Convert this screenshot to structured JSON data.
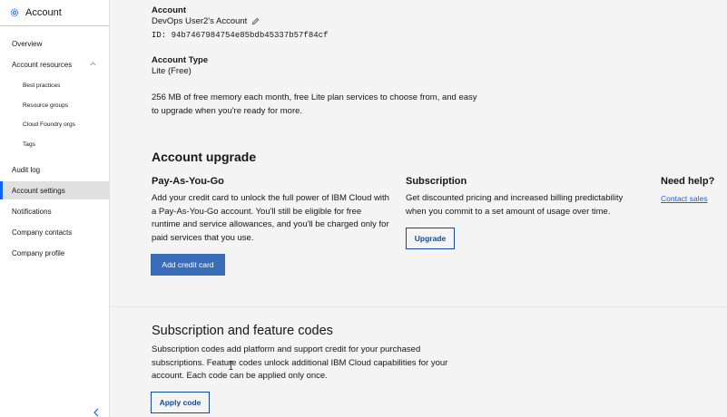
{
  "sidebar": {
    "title": "Account",
    "items": [
      {
        "label": "Overview"
      },
      {
        "label": "Account resources"
      },
      {
        "label": "Best practices"
      },
      {
        "label": "Resource groups"
      },
      {
        "label": "Cloud Foundry orgs"
      },
      {
        "label": "Tags"
      },
      {
        "label": "Audit log"
      },
      {
        "label": "Account settings"
      },
      {
        "label": "Notifications"
      },
      {
        "label": "Company contacts"
      },
      {
        "label": "Company profile"
      }
    ],
    "active_item": "Account settings"
  },
  "account": {
    "heading": "Account",
    "name": "DevOps User2's Account",
    "id": "ID: 94b7467984754e85bdb45337b57f84cf",
    "type_heading": "Account Type",
    "type_value": "Lite (Free)",
    "description_line1": "256 MB of free memory each month, free Lite plan services to choose from, and easy",
    "description_line2": "to upgrade when you're ready for more."
  },
  "upgrade": {
    "heading": "Account upgrade",
    "payg": {
      "title": "Pay-As-You-Go",
      "lines": [
        "Add your credit card to unlock the full power of IBM Cloud with",
        "a Pay-As-You-Go account. You'll still be eligible for free",
        "runtime and service allowances, and you'll be charged only for",
        "paid services that you use."
      ],
      "button": "Add credit card"
    },
    "subscription": {
      "title": "Subscription",
      "lines": [
        "Get discounted pricing and increased billing predictability",
        "when you commit to a set amount of usage over time."
      ],
      "button": "Upgrade"
    },
    "help": {
      "title": "Need help?",
      "link": "Contact sales"
    }
  },
  "codes": {
    "heading": "Subscription and feature codes",
    "lines": [
      "Subscription codes add platform and support credit for your purchased",
      "subscriptions. Feature codes unlock additional IBM Cloud capabilities for your",
      "account. Each code can be applied only once."
    ],
    "button": "Apply code"
  },
  "colors": {
    "primary_button": "#3a6db8",
    "link": "#0f62fe",
    "active_indicator": "#0f62fe"
  }
}
